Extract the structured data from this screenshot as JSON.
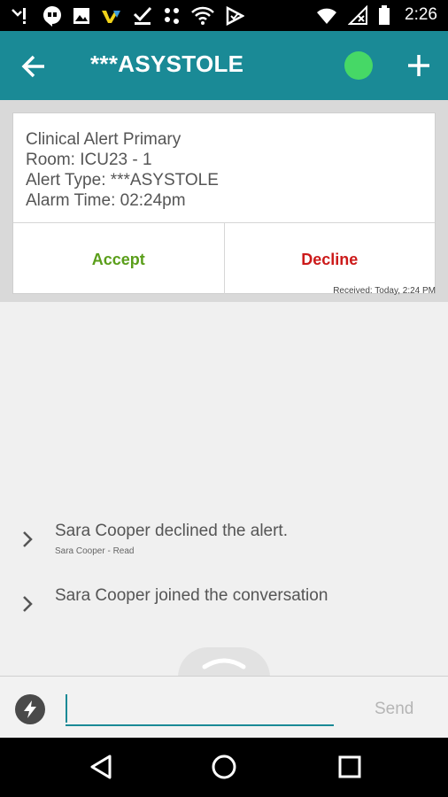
{
  "status_bar": {
    "time": "2:26",
    "left_icons": [
      "missed-call-icon",
      "hangouts-icon",
      "image-icon",
      "vimeo-icon",
      "checkmark-icon",
      "dots-icon",
      "wifi-icon",
      "tasker-icon"
    ],
    "right_icons": [
      "signal-icon",
      "no-sim-icon",
      "battery-icon"
    ]
  },
  "app_bar": {
    "title": "***ASYSTOLE",
    "presence_color": "#46d866",
    "background_color": "#1a8a96"
  },
  "alert": {
    "line1": "Clinical Alert Primary",
    "line2": "Room: ICU23 - 1",
    "line3": "Alert Type: ***ASYSTOLE",
    "line4": "Alarm Time: 02:24pm",
    "accept_label": "Accept",
    "decline_label": "Decline",
    "accept_color": "#5a9e1a",
    "decline_color": "#cc1a1a",
    "received": "Received: Today, 2:24 PM"
  },
  "messages": [
    {
      "text": "Sara Cooper declined the alert.",
      "sub": "Sara Cooper - Read"
    },
    {
      "text": "Sara Cooper joined the conversation",
      "sub": ""
    }
  ],
  "compose": {
    "value": "",
    "placeholder": "",
    "send_label": "Send"
  },
  "nav_bar": {
    "buttons": [
      "back-triangle-icon",
      "home-circle-icon",
      "recents-square-icon"
    ]
  }
}
